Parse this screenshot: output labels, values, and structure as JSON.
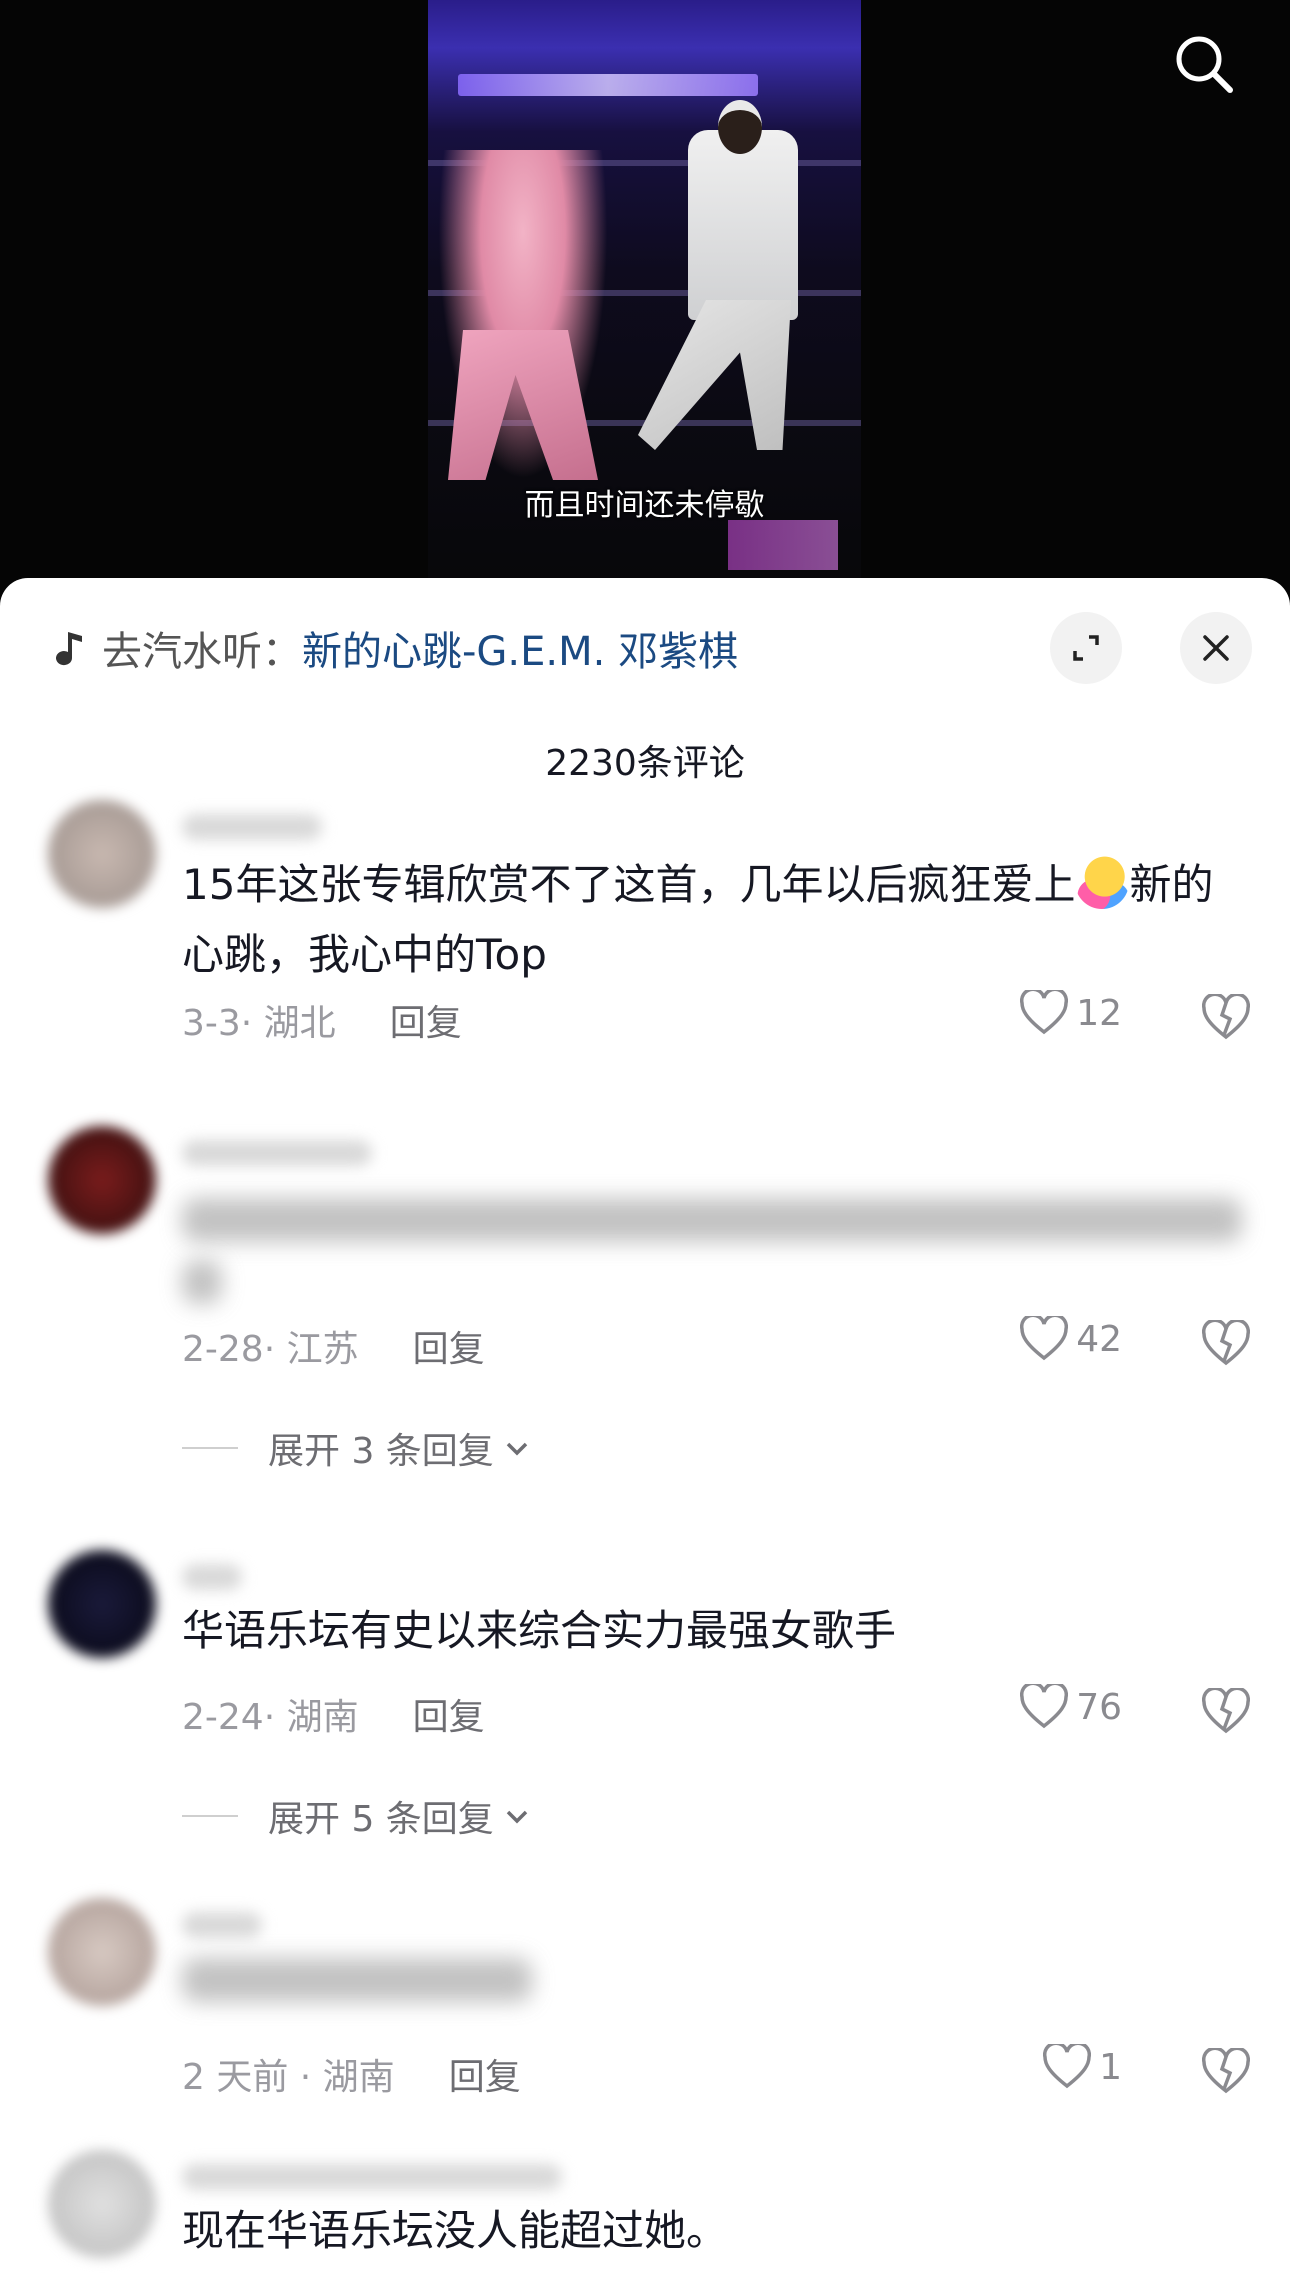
{
  "video": {
    "subtitle": "而且时间还未停歇"
  },
  "music": {
    "prefix": "去汽水听：",
    "title": "新的心跳-G.E.M. 邓紫棋"
  },
  "comments_header": {
    "count_label": "2230条评论"
  },
  "comments": [
    {
      "text_part1": "15年这张专辑欣赏不了这首，几年以后疯狂爱上",
      "text_part2": "新的心跳，我心中的Top",
      "date_location": "3-3· 湖北",
      "reply_label": "回复",
      "likes": "12"
    },
    {
      "date_location": "2-28· 江苏",
      "reply_label": "回复",
      "likes": "42",
      "expand_replies": "展开 3 条回复"
    },
    {
      "text": "华语乐坛有史以来综合实力最强女歌手",
      "date_location": "2-24· 湖南",
      "reply_label": "回复",
      "likes": "76",
      "expand_replies": "展开 5 条回复"
    },
    {
      "date_location": "2 天前 · 湖南",
      "reply_label": "回复",
      "likes": "1"
    },
    {
      "text": "现在华语乐坛没人能超过她。"
    }
  ],
  "colors": {
    "link_blue": "#1b4a82",
    "meta_gray": "#9a9aa0",
    "text_dark": "#161823"
  }
}
